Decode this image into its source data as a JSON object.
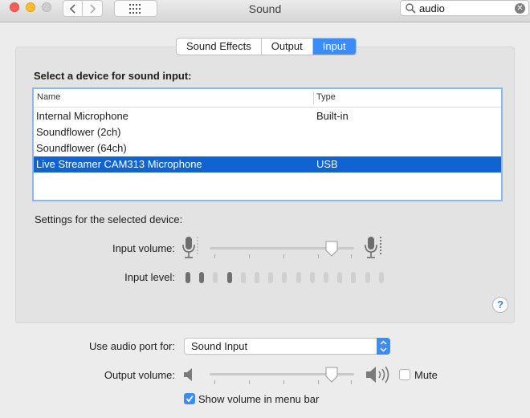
{
  "window": {
    "title": "Sound"
  },
  "search": {
    "value": "audio"
  },
  "tabs": [
    {
      "label": "Sound Effects",
      "selected": false
    },
    {
      "label": "Output",
      "selected": false
    },
    {
      "label": "Input",
      "selected": true
    }
  ],
  "input_panel": {
    "heading": "Select a device for sound input:",
    "columns": [
      "Name",
      "Type"
    ],
    "devices": [
      {
        "name": "Internal Microphone",
        "type": "Built-in",
        "selected": false
      },
      {
        "name": "Soundflower (2ch)",
        "type": "",
        "selected": false
      },
      {
        "name": "Soundflower (64ch)",
        "type": "",
        "selected": false
      },
      {
        "name": "Live Streamer CAM313 Microphone",
        "type": "USB",
        "selected": true
      }
    ],
    "settings_label": "Settings for the selected device:",
    "input_volume_label": "Input volume:",
    "input_volume_fraction": 0.88,
    "input_level_label": "Input level:",
    "input_level_total": 15,
    "input_level_active": [
      0,
      1,
      3
    ]
  },
  "footer": {
    "audio_port_label": "Use audio port for:",
    "audio_port_value": "Sound Input",
    "output_volume_label": "Output volume:",
    "output_volume_fraction": 0.88,
    "mute_label": "Mute",
    "mute_checked": false,
    "menu_bar_label": "Show volume in menu bar",
    "menu_bar_checked": true
  },
  "colors": {
    "accent": "#3b8cf7",
    "selection": "#0f64d2"
  }
}
